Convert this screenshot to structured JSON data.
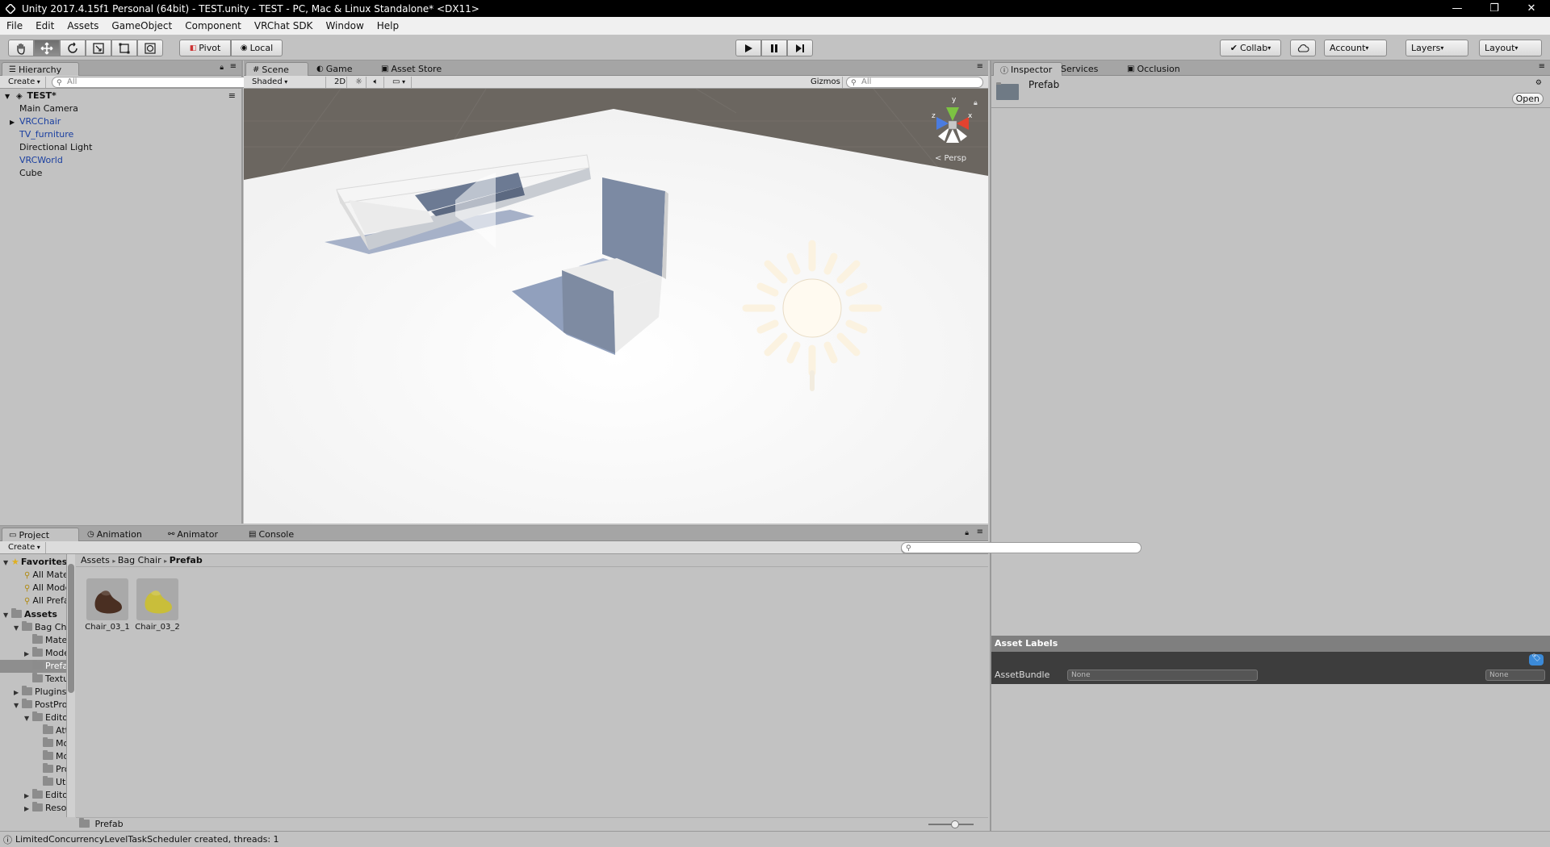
{
  "window": {
    "title": "Unity 2017.4.15f1 Personal (64bit) - TEST.unity - TEST - PC, Mac & Linux Standalone* <DX11>",
    "minimize": "—",
    "restore": "❐",
    "close": "✕"
  },
  "menu": [
    "File",
    "Edit",
    "Assets",
    "GameObject",
    "Component",
    "VRChat SDK",
    "Window",
    "Help"
  ],
  "toolbar": {
    "pivot": "Pivot",
    "local": "Local",
    "collab": "Collab",
    "account": "Account",
    "layers": "Layers",
    "layout": "Layout"
  },
  "hierarchy": {
    "tab": "Hierarchy",
    "create": "Create",
    "search_placeholder": "All",
    "scene": "TEST*",
    "items": [
      {
        "label": "Main Camera",
        "prefab": false,
        "expandable": false
      },
      {
        "label": "VRCChair",
        "prefab": true,
        "expandable": true
      },
      {
        "label": "TV_furniture",
        "prefab": true,
        "expandable": false
      },
      {
        "label": "Directional Light",
        "prefab": false,
        "expandable": false
      },
      {
        "label": "VRCWorld",
        "prefab": true,
        "expandable": false
      },
      {
        "label": "Cube",
        "prefab": false,
        "expandable": false
      }
    ]
  },
  "scene": {
    "tabs": [
      "Scene",
      "Game",
      "Asset Store"
    ],
    "shading": "Shaded",
    "mode_2d": "2D",
    "gizmos": "Gizmos",
    "search_placeholder": "All",
    "persp": "< Persp",
    "axis_x": "x",
    "axis_y": "y",
    "axis_z": "z"
  },
  "inspector": {
    "tabs": [
      "Inspector",
      "Services",
      "Occlusion"
    ],
    "object_name": "Prefab",
    "open_button": "Open",
    "asset_labels": "Asset Labels",
    "asset_bundle_label": "AssetBundle",
    "asset_bundle_value": "None",
    "asset_bundle_variant": "None"
  },
  "project": {
    "tabs": [
      "Project",
      "Animation",
      "Animator",
      "Console"
    ],
    "create": "Create",
    "breadcrumb": [
      "Assets",
      "Bag Chair",
      "Prefab"
    ],
    "favorites_label": "Favorites",
    "favorites": [
      "All Materi",
      "All Model",
      "All Prefab"
    ],
    "assets_label": "Assets",
    "tree": [
      {
        "label": "Bag Chai",
        "depth": 1,
        "arrow": "▼"
      },
      {
        "label": "Materi",
        "depth": 2,
        "arrow": ""
      },
      {
        "label": "Model",
        "depth": 2,
        "arrow": "▶"
      },
      {
        "label": "Prefab",
        "depth": 2,
        "arrow": "",
        "selected": true
      },
      {
        "label": "Textur",
        "depth": 2,
        "arrow": ""
      },
      {
        "label": "Plugins",
        "depth": 1,
        "arrow": "▶"
      },
      {
        "label": "PostProce",
        "depth": 1,
        "arrow": "▼"
      },
      {
        "label": "Editor",
        "depth": 2,
        "arrow": "▼"
      },
      {
        "label": "Attri",
        "depth": 3,
        "arrow": ""
      },
      {
        "label": "Mod",
        "depth": 3,
        "arrow": ""
      },
      {
        "label": "Mon",
        "depth": 3,
        "arrow": ""
      },
      {
        "label": "Prop",
        "depth": 3,
        "arrow": ""
      },
      {
        "label": "Utils",
        "depth": 3,
        "arrow": ""
      },
      {
        "label": "Editor",
        "depth": 2,
        "arrow": "▶"
      },
      {
        "label": "Resour",
        "depth": 2,
        "arrow": "▶"
      }
    ],
    "files": [
      {
        "label": "Chair_03_1",
        "color": "#4a2f22"
      },
      {
        "label": "Chair_03_2",
        "color": "#c9be3a"
      }
    ],
    "footer_path": "Prefab"
  },
  "status": {
    "message": "LimitedConcurrencyLevelTaskScheduler created, threads: 1"
  }
}
